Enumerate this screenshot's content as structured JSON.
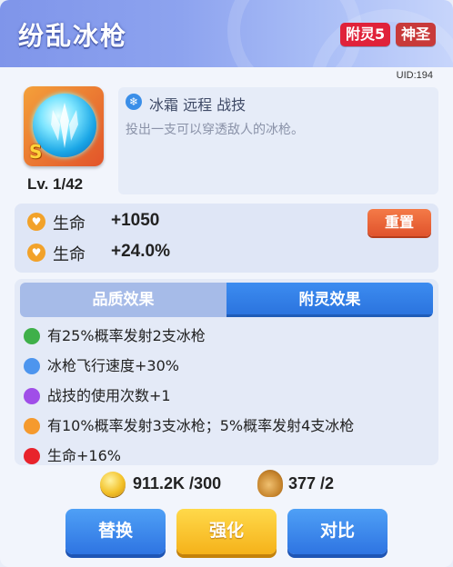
{
  "header": {
    "title": "纷乱冰枪",
    "enchant_badge": "附灵5",
    "rarity_badge": "神圣"
  },
  "uid": "UID:194",
  "skill": {
    "icon": "ice-spear-icon",
    "level": "Lv. 1/42",
    "tags": "冰霜 远程 战技",
    "description": "投出一支可以穿透敌人的冰枪。"
  },
  "stats": [
    {
      "label": "生命",
      "value": "+1050"
    },
    {
      "label": "生命",
      "value": "+24.0%"
    }
  ],
  "reset_label": "重置",
  "tabs": [
    {
      "label": "品质效果",
      "active": false
    },
    {
      "label": "附灵效果",
      "active": true
    }
  ],
  "effects": [
    {
      "color": "green",
      "text": "有25%概率发射2支冰枪"
    },
    {
      "color": "blue",
      "text": "冰枪飞行速度+30%"
    },
    {
      "color": "purple",
      "text": "战技的使用次数+1"
    },
    {
      "color": "orange",
      "text": "有10%概率发射3支冰枪；5%概率发射4支冰枪"
    },
    {
      "color": "red",
      "text": "生命+16%"
    }
  ],
  "currency": {
    "coins": "911.2K /300",
    "bags": "377 /2"
  },
  "buttons": {
    "replace": "替换",
    "enhance": "强化",
    "compare": "对比"
  },
  "colors": {
    "accent_blue": "#2e74e2",
    "enhance_yellow": "#f5b21a",
    "reset_orange": "#e0532c",
    "badge_red": "#e0223a"
  }
}
